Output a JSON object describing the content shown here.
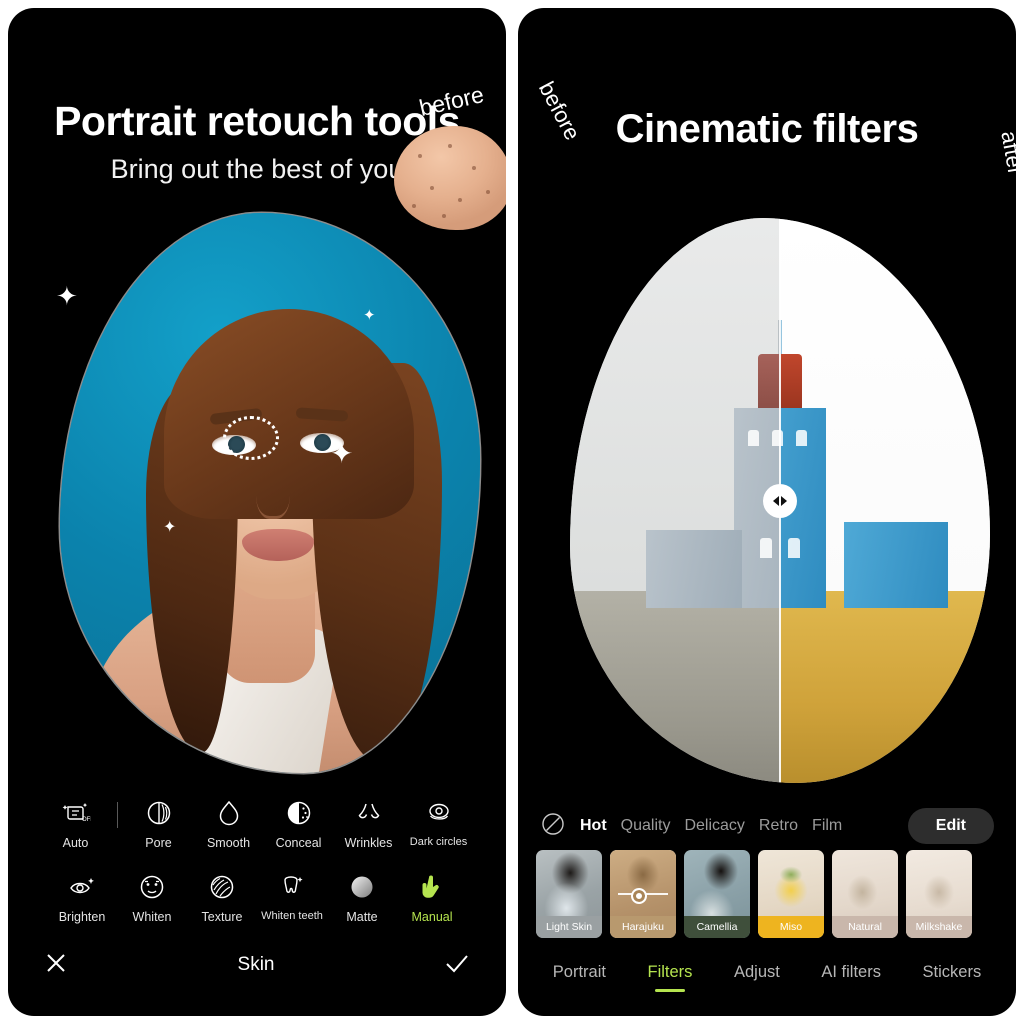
{
  "left_panel": {
    "title": "Portrait retouch tools",
    "subtitle": "Bring out the best of you",
    "compare_label_before": "before",
    "tool_rows": [
      [
        {
          "label": "Auto",
          "icon": "auto-sparkle-icon",
          "badge": "OFF",
          "active": false
        },
        {
          "label": "Pore",
          "icon": "pore-circle-icon",
          "active": false
        },
        {
          "label": "Smooth",
          "icon": "droplet-icon",
          "active": false
        },
        {
          "label": "Conceal",
          "icon": "conceal-circle-icon",
          "active": false
        },
        {
          "label": "Wrinkles",
          "icon": "nose-wrinkles-icon",
          "active": false
        },
        {
          "label": "Dark circles",
          "icon": "eye-dark-circles-icon",
          "active": false
        }
      ],
      [
        {
          "label": "Brighten",
          "icon": "eye-sparkle-icon",
          "active": false
        },
        {
          "label": "Whiten",
          "icon": "face-whiten-icon",
          "active": false
        },
        {
          "label": "Texture",
          "icon": "texture-swirl-icon",
          "active": false
        },
        {
          "label": "Whiten teeth",
          "icon": "tooth-sparkle-icon",
          "active": false
        },
        {
          "label": "Matte",
          "icon": "matte-sphere-icon",
          "active": false
        },
        {
          "label": "Manual",
          "icon": "pointing-hand-icon",
          "active": true
        }
      ]
    ],
    "bottom_bar": {
      "cancel_icon": "close-x-icon",
      "title": "Skin",
      "confirm_icon": "checkmark-icon"
    }
  },
  "right_panel": {
    "title": "Cinematic filters",
    "compare_label_before": "before",
    "compare_label_after": "after",
    "compare_handle_icon": "left-right-arrows-icon",
    "filter_categories": [
      {
        "label": "",
        "icon": "none-slash-icon",
        "active": false
      },
      {
        "label": "Hot",
        "active": true
      },
      {
        "label": "Quality",
        "active": false
      },
      {
        "label": "Delicacy",
        "active": false
      },
      {
        "label": "Retro",
        "active": false
      },
      {
        "label": "Film",
        "active": false
      }
    ],
    "edit_button": "Edit",
    "filter_thumbnails": [
      {
        "label": "Light Skin",
        "caption_color": "#9aa0a2",
        "selected": false
      },
      {
        "label": "Harajuku",
        "caption_color": "#b8996e",
        "selected": true
      },
      {
        "label": "Camellia",
        "caption_color": "#3f4f3b",
        "selected": false
      },
      {
        "label": "Miso",
        "caption_color": "#eeb41f",
        "selected": false
      },
      {
        "label": "Natural",
        "caption_color": "#c9b7ab",
        "selected": false
      },
      {
        "label": "Milkshake",
        "caption_color": "#c9b7ab",
        "selected": false
      }
    ],
    "nav_items": [
      {
        "label": "Portrait",
        "active": false
      },
      {
        "label": "Filters",
        "active": true
      },
      {
        "label": "Adjust",
        "active": false
      },
      {
        "label": "AI filters",
        "active": false
      },
      {
        "label": "Stickers",
        "active": false
      }
    ]
  },
  "colors": {
    "accent_green": "#b5e44f",
    "background": "#000000",
    "portrait_backdrop": "#0e8db8",
    "miso_amber": "#eeb41f"
  }
}
